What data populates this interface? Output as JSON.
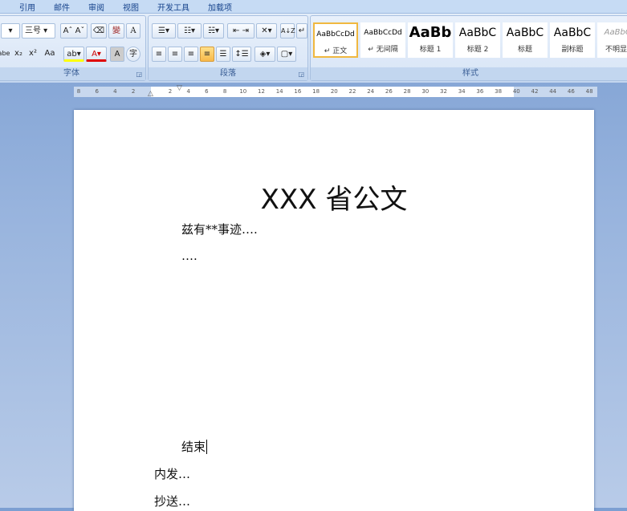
{
  "tabs": [
    "引用",
    "邮件",
    "审阅",
    "视图",
    "开发工具",
    "加载项"
  ],
  "font_group": {
    "label": "字体",
    "size": "三号",
    "grow": "Aˆ",
    "shrink": "Aˇ",
    "phonetic": "變",
    "border_char": "A",
    "strike": "abe",
    "sub": "x₂",
    "sup": "x²",
    "case": "Aa",
    "highlight": "ab",
    "color": "A",
    "shade": "A",
    "enclose": "字"
  },
  "paragraph_group": {
    "label": "段落",
    "sort": "A↓Z",
    "marks": "↵"
  },
  "styles_group": {
    "label": "样式",
    "styles": [
      {
        "sample": "AaBbCcDd",
        "name": "↵ 正文",
        "selected": true
      },
      {
        "sample": "AaBbCcDd",
        "name": "↵ 无间隔"
      },
      {
        "sample": "AaBb",
        "name": "标题 1"
      },
      {
        "sample": "AaBbC",
        "name": "标题 2"
      },
      {
        "sample": "AaBbC",
        "name": "标题"
      },
      {
        "sample": "AaBbC",
        "name": "副标题"
      },
      {
        "sample": "AaBbCc",
        "name": "不明显强"
      }
    ]
  },
  "ruler": {
    "left": [
      "8",
      "6",
      "4",
      "2"
    ],
    "right": [
      "2",
      "4",
      "6",
      "8",
      "10",
      "12",
      "14",
      "16",
      "18",
      "20",
      "22",
      "24",
      "26",
      "28",
      "30",
      "32",
      "34",
      "36",
      "38",
      "40",
      "42",
      "44",
      "46",
      "48"
    ]
  },
  "document": {
    "title": "XXX 省公文",
    "line1": "兹有**事迹….",
    "line2": "….",
    "end": "结束",
    "internal": "内发…",
    "cc": "抄送…"
  },
  "colors": {
    "accent": "#15428b",
    "highlight": "#ffff00",
    "font_color": "#e00000"
  }
}
